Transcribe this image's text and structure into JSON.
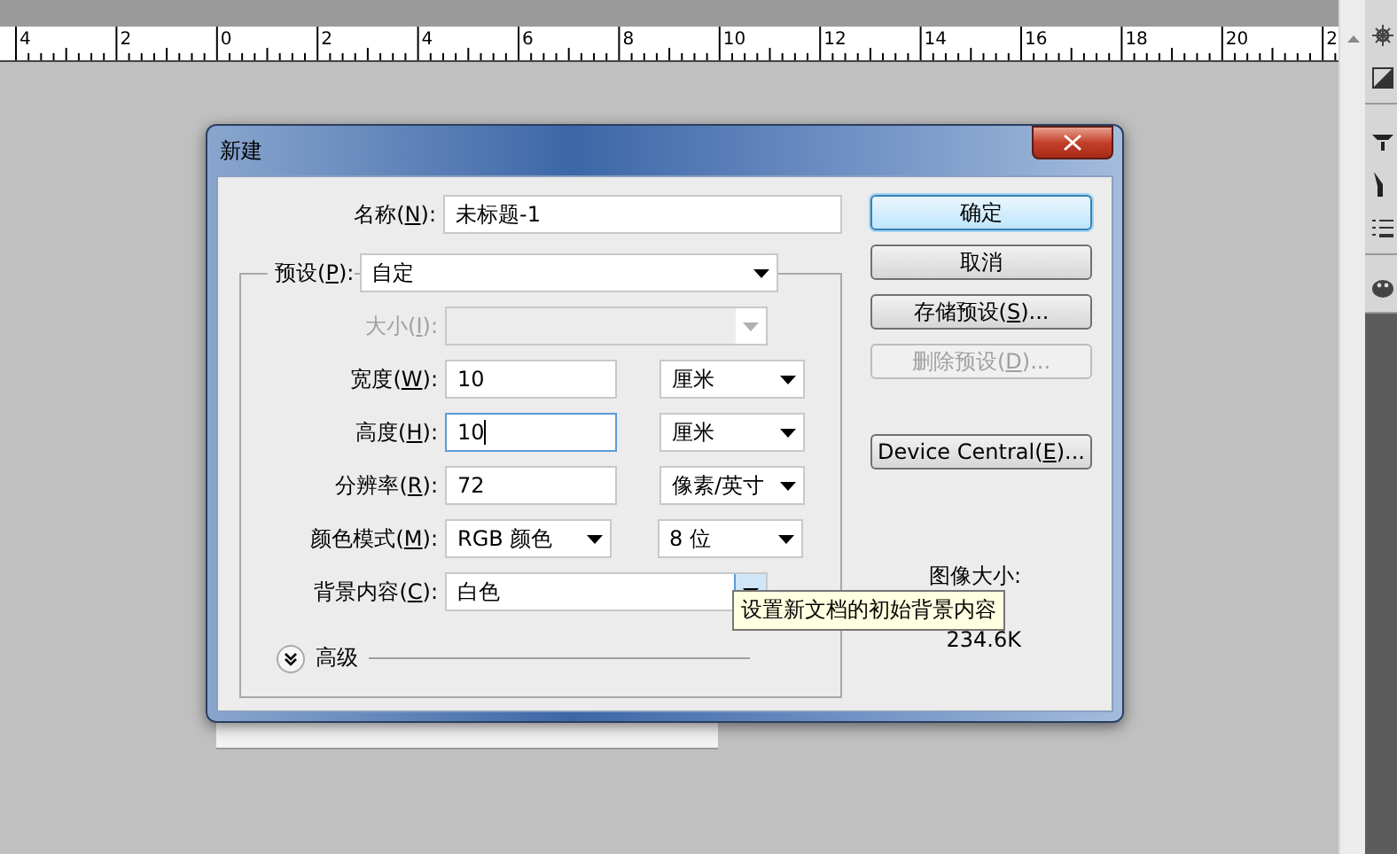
{
  "ruler": {
    "labels": [
      "4",
      "2",
      "0",
      "2",
      "4",
      "6",
      "8",
      "10",
      "12",
      "14",
      "16",
      "18",
      "20",
      "2"
    ]
  },
  "dialog": {
    "title": "新建",
    "name_field": {
      "before": "名称(",
      "key": "N",
      "after": "):",
      "value": "未标题-1"
    },
    "preset": {
      "before": "预设(",
      "key": "P",
      "after": "):",
      "value": "自定"
    },
    "rows": [
      {
        "kind": "select",
        "before": "大小(",
        "key": "I",
        "after": "):",
        "disabled": true,
        "hovered": false
      },
      {
        "kind": "measure",
        "before": "宽度(",
        "key": "W",
        "after": "):",
        "value": "10",
        "unit": "厘米",
        "focused": false
      },
      {
        "kind": "measure",
        "before": "高度(",
        "key": "H",
        "after": "):",
        "value": "10",
        "unit": "厘米",
        "focused": true
      },
      {
        "kind": "measure",
        "before": "分辨率(",
        "key": "R",
        "after": "):",
        "value": "72",
        "unit": "像素/英寸",
        "focused": false
      },
      {
        "kind": "select_pair",
        "before": "颜色模式(",
        "key": "M",
        "after": "):",
        "value": "RGB 颜色",
        "unit": "8 位"
      },
      {
        "kind": "select",
        "before": "背景内容(",
        "key": "C",
        "after": "):",
        "value": "白色",
        "disabled": false,
        "hovered": true
      }
    ],
    "advanced": {
      "label": "高级",
      "expanded": false
    },
    "buttons": [
      {
        "before": "确定",
        "default": true,
        "disabled": false
      },
      {
        "before": "取消",
        "default": false,
        "disabled": false
      },
      {
        "before": "存储预设(",
        "key": "S",
        "after": ")...",
        "default": false,
        "disabled": false
      },
      {
        "before": "删除预设(",
        "key": "D",
        "after": ")...",
        "default": false,
        "disabled": true
      },
      {
        "before": "Device Central(",
        "key": "E",
        "after": ")...",
        "default": false,
        "disabled": false
      }
    ],
    "image_size": {
      "label": "图像大小:",
      "value": "234.6K"
    },
    "tooltip": "设置新文档的初始背景内容"
  }
}
